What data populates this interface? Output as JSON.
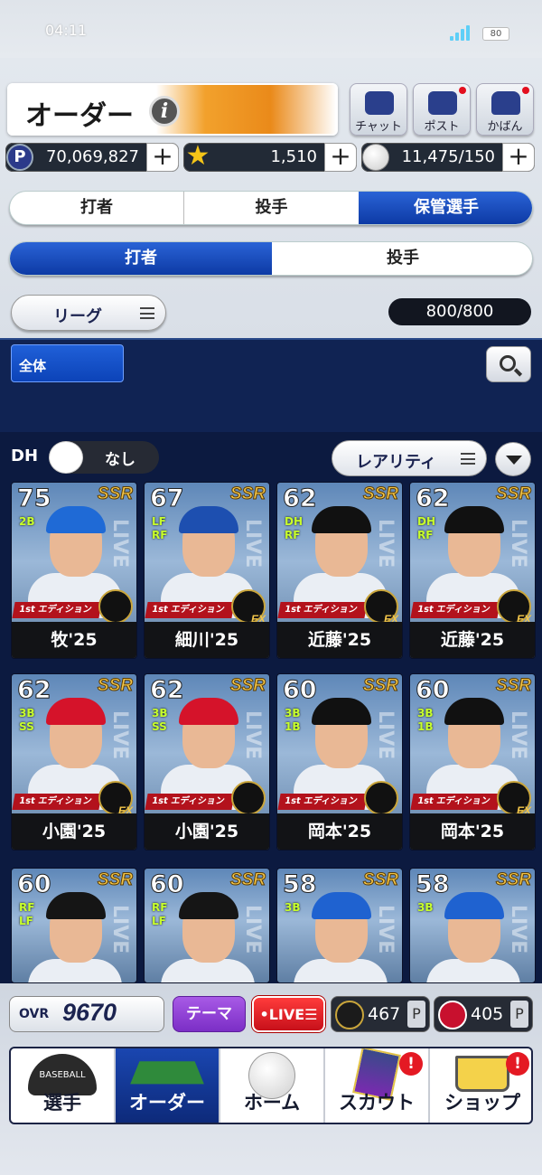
{
  "status": {
    "time": "04:11",
    "battery": "80"
  },
  "header": {
    "title": "オーダー",
    "info_icon": "i",
    "buttons": [
      {
        "label": "チャット",
        "icon": "chat-icon"
      },
      {
        "label": "ポスト",
        "icon": "mail-icon"
      },
      {
        "label": "かばん",
        "icon": "bag-icon"
      }
    ]
  },
  "currencies": [
    {
      "icon_text": "P",
      "value": "70,069,827"
    },
    {
      "icon_text": "★",
      "value": "1,510"
    },
    {
      "icon_text": "",
      "value": "11,475/150"
    }
  ],
  "plus_label": "+",
  "main_tabs": [
    "打者",
    "投手",
    "保管選手"
  ],
  "main_tab_selected": "保管選手",
  "sub_tabs": [
    "打者",
    "投手"
  ],
  "sub_tab_selected": "打者",
  "filters": {
    "league_label": "リーグ",
    "count": "800/800",
    "all_label": "全体"
  },
  "dh": {
    "label": "DH",
    "toggle_text": "なし",
    "rarity_label": "レアリティ"
  },
  "cards": [
    {
      "ovr": "75",
      "pos": [
        "2B"
      ],
      "rarity": "SSR",
      "name": "牧'25",
      "edition": "1st エディション",
      "cap": "#1f6ad6",
      "badge": ""
    },
    {
      "ovr": "67",
      "pos": [
        "LF",
        "RF"
      ],
      "rarity": "SSR",
      "name": "細川'25",
      "edition": "1st エディション",
      "cap": "#1d4fb0",
      "badge": "EX"
    },
    {
      "ovr": "62",
      "pos": [
        "DH",
        "RF"
      ],
      "rarity": "SSR",
      "name": "近藤'25",
      "edition": "1st エディション",
      "cap": "#111111",
      "badge": "EX"
    },
    {
      "ovr": "62",
      "pos": [
        "DH",
        "RF"
      ],
      "rarity": "SSR",
      "name": "近藤'25",
      "edition": "1st エディション",
      "cap": "#111111",
      "badge": "EX"
    },
    {
      "ovr": "62",
      "pos": [
        "3B",
        "SS"
      ],
      "rarity": "SSR",
      "name": "小園'25",
      "edition": "1st エディション",
      "cap": "#d5132a",
      "badge": "EX"
    },
    {
      "ovr": "62",
      "pos": [
        "3B",
        "SS"
      ],
      "rarity": "SSR",
      "name": "小園'25",
      "edition": "1st エディション",
      "cap": "#d5132a",
      "badge": ""
    },
    {
      "ovr": "60",
      "pos": [
        "3B",
        "1B"
      ],
      "rarity": "SSR",
      "name": "岡本'25",
      "edition": "1st エディション",
      "cap": "#111111",
      "badge": ""
    },
    {
      "ovr": "60",
      "pos": [
        "3B",
        "1B"
      ],
      "rarity": "SSR",
      "name": "岡本'25",
      "edition": "1st エディション",
      "cap": "#111111",
      "badge": "EX"
    },
    {
      "ovr": "60",
      "pos": [
        "RF",
        "LF"
      ],
      "rarity": "SSR",
      "name": "",
      "edition": "",
      "cap": "#151515",
      "badge": ""
    },
    {
      "ovr": "60",
      "pos": [
        "RF",
        "LF"
      ],
      "rarity": "SSR",
      "name": "",
      "edition": "",
      "cap": "#151515",
      "badge": ""
    },
    {
      "ovr": "58",
      "pos": [
        "3B"
      ],
      "rarity": "SSR",
      "name": "",
      "edition": "",
      "cap": "#1f62d0",
      "badge": ""
    },
    {
      "ovr": "58",
      "pos": [
        "3B"
      ],
      "rarity": "SSR",
      "name": "",
      "edition": "",
      "cap": "#1f62d0",
      "badge": ""
    }
  ],
  "live_text": "LIVE",
  "footer": {
    "ovr_label": "OVR",
    "ovr_value": "9670",
    "theme_label": "テーマ",
    "live_label": "•LIVE☰",
    "points": [
      {
        "value": "467",
        "unit": "P",
        "color": "#2a2a2a"
      },
      {
        "value": "405",
        "unit": "P",
        "color": "#c8102e"
      }
    ]
  },
  "nav": [
    {
      "label": "選手",
      "icon": "cap-icon",
      "sub": "BASEBALL",
      "alert": ""
    },
    {
      "label": "オーダー",
      "icon": "field-icon",
      "sub": "",
      "alert": ""
    },
    {
      "label": "ホーム",
      "icon": "ball-icon",
      "sub": "",
      "alert": ""
    },
    {
      "label": "スカウト",
      "icon": "scout-cards-icon",
      "sub": "",
      "alert": "!"
    },
    {
      "label": "ショップ",
      "icon": "cart-icon",
      "sub": "",
      "alert": "!"
    }
  ],
  "colors": {
    "accent": "#0d3aa5",
    "navy": "#0c1a40",
    "orange": "#f2a12c"
  }
}
